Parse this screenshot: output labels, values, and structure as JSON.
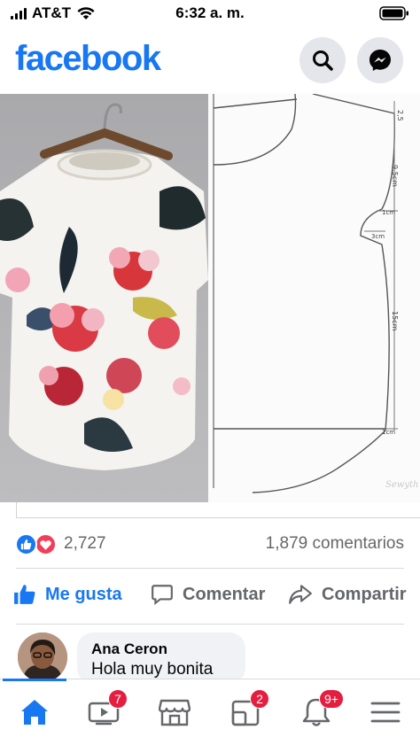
{
  "status_bar": {
    "carrier": "AT&T",
    "time": "6:32 a. m."
  },
  "header": {
    "logo": "facebook",
    "search_icon": "search-icon",
    "messenger_icon": "messenger-icon"
  },
  "post": {
    "image_left": "floral blouse photo",
    "image_right": "sewing pattern drawing",
    "pattern_labels": [
      "2,5",
      "9,5cm",
      "1cm",
      "3cm",
      "15cm",
      "1cm"
    ],
    "watermark": "Sewyth"
  },
  "reactions": {
    "count": "2,727",
    "comments": "1,879 comentarios"
  },
  "actions": {
    "like": "Me gusta",
    "comment": "Comentar",
    "share": "Compartir"
  },
  "comment": {
    "author": "Ana Ceron",
    "text": "Hola muy bonita"
  },
  "bottom_nav": {
    "items": [
      {
        "icon": "home-icon",
        "badge": ""
      },
      {
        "icon": "watch-icon",
        "badge": "7"
      },
      {
        "icon": "marketplace-icon",
        "badge": ""
      },
      {
        "icon": "groups-icon",
        "badge": "2"
      },
      {
        "icon": "notifications-icon",
        "badge": "9+"
      },
      {
        "icon": "menu-icon",
        "badge": ""
      }
    ]
  },
  "colors": {
    "brand": "#1877f2",
    "badge": "#e41e3f",
    "muted": "#65676b"
  }
}
